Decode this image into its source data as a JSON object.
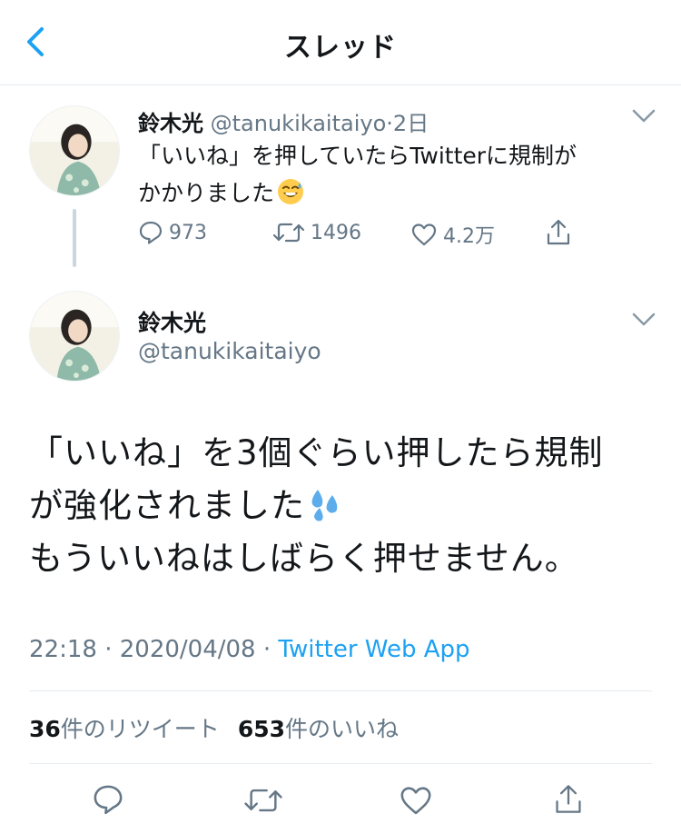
{
  "header": {
    "title": "スレッド"
  },
  "parent_tweet": {
    "name": "鈴木光",
    "handle": "@tanukikaitaiyo",
    "separator": "·",
    "time": "2日",
    "text_line1": "「いいね」を押していたらTwitterに規制が",
    "text_line2": "かかりました",
    "emoji": "sweat-smile-emoji",
    "replies": "973",
    "retweets": "1496",
    "likes": "4.2万"
  },
  "main_tweet": {
    "name": "鈴木光",
    "handle": "@tanukikaitaiyo",
    "line1": "「いいね」を3個ぐらい押したら規制",
    "line2": "が強化されました",
    "line2_emoji": "sweat-droplets-emoji",
    "line3": "もういいねはしばらく押せません。",
    "time": "22:18",
    "separator": "·",
    "date": "2020/04/08",
    "source_separator": "·",
    "source": "Twitter Web App",
    "retweet_count": "36",
    "retweet_label": "件のリツイート",
    "like_count": "653",
    "like_label": "件のいいね"
  },
  "colors": {
    "accent": "#1da1f2",
    "secondary_text": "#657786",
    "primary_text": "#14171a",
    "divider": "#e6ecf0"
  }
}
